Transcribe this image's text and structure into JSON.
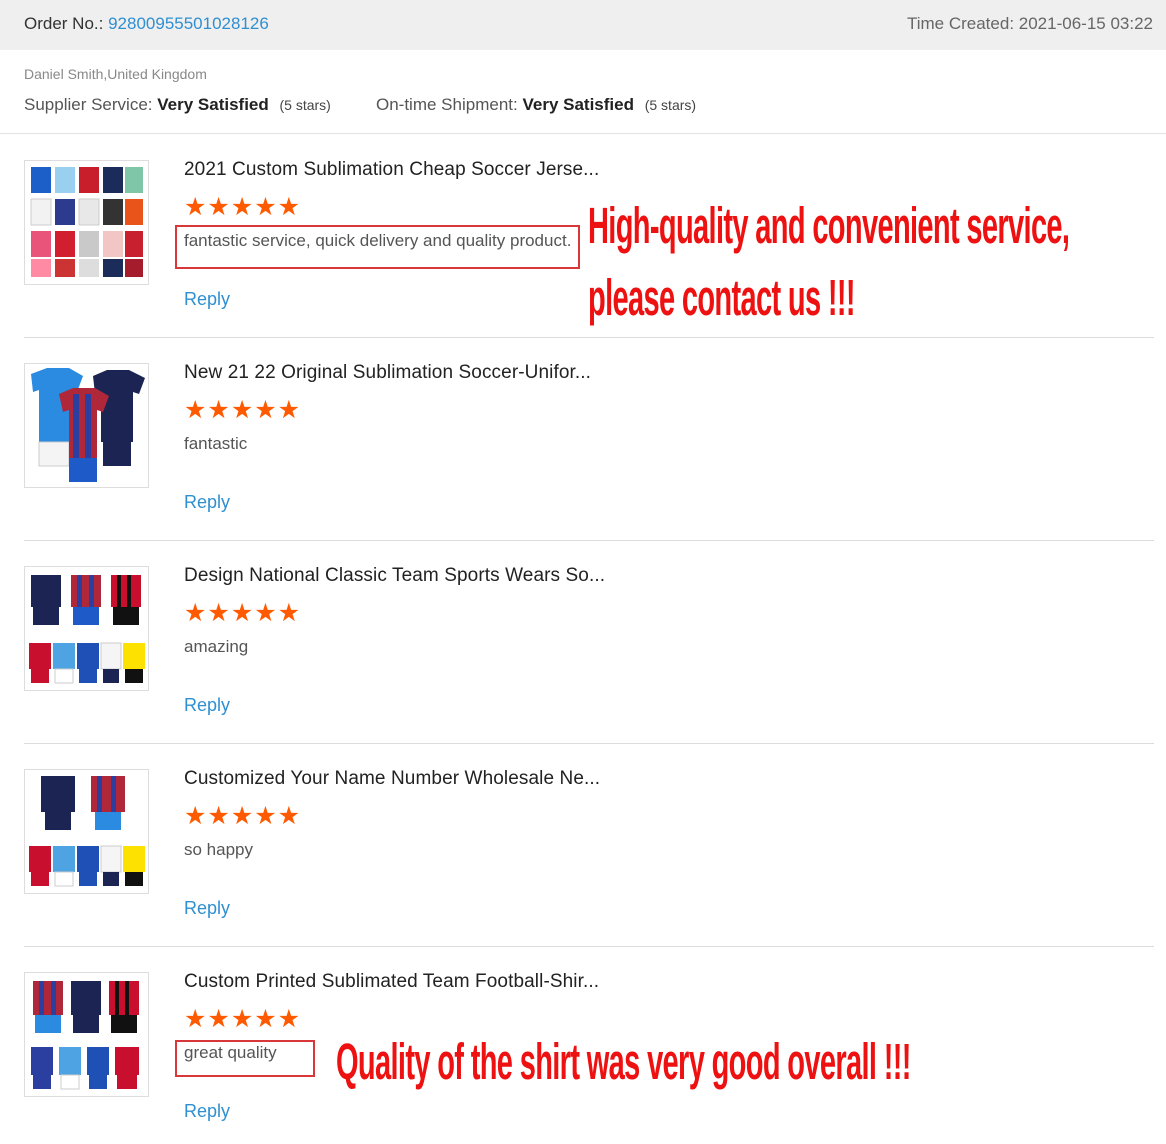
{
  "order": {
    "label": "Order No.:",
    "number": "92800955501028126",
    "created": "Time Created: 2021-06-15 03:22"
  },
  "customer": "Daniel Smith,United Kingdom",
  "ratings": {
    "supplier_label": "Supplier Service:",
    "supplier_value": "Very Satisfied",
    "supplier_stars": "(5 stars)",
    "shipment_label": "On-time Shipment:",
    "shipment_value": "Very Satisfied",
    "shipment_stars": "(5 stars)"
  },
  "star_glyphs": "★★★★★",
  "colors": {
    "accent": "#2f8fd1",
    "stars": "#ff5a00",
    "promo": "#ee1111",
    "highlight_box": "#d9383b"
  },
  "reviews": [
    {
      "title": "2021 Custom Sublimation Cheap Soccer Jerse...",
      "rating": 5,
      "comment": "fantastic service, quick delivery and quality product.",
      "reply": "Reply"
    },
    {
      "title": "New 21 22 Original Sublimation Soccer-Unifor...",
      "rating": 5,
      "comment": "fantastic",
      "reply": "Reply"
    },
    {
      "title": "Design National Classic Team Sports Wears So...",
      "rating": 5,
      "comment": "amazing",
      "reply": "Reply"
    },
    {
      "title": "Customized Your Name Number Wholesale Ne...",
      "rating": 5,
      "comment": "so happy",
      "reply": "Reply"
    },
    {
      "title": "Custom Printed Sublimated Team Football-Shir...",
      "rating": 5,
      "comment": "great quality",
      "reply": "Reply"
    }
  ],
  "promo": {
    "line1": "High-quality and convenient service,",
    "line2": "please contact us !!!",
    "line3": "Quality of the shirt was very good overall !!!"
  }
}
